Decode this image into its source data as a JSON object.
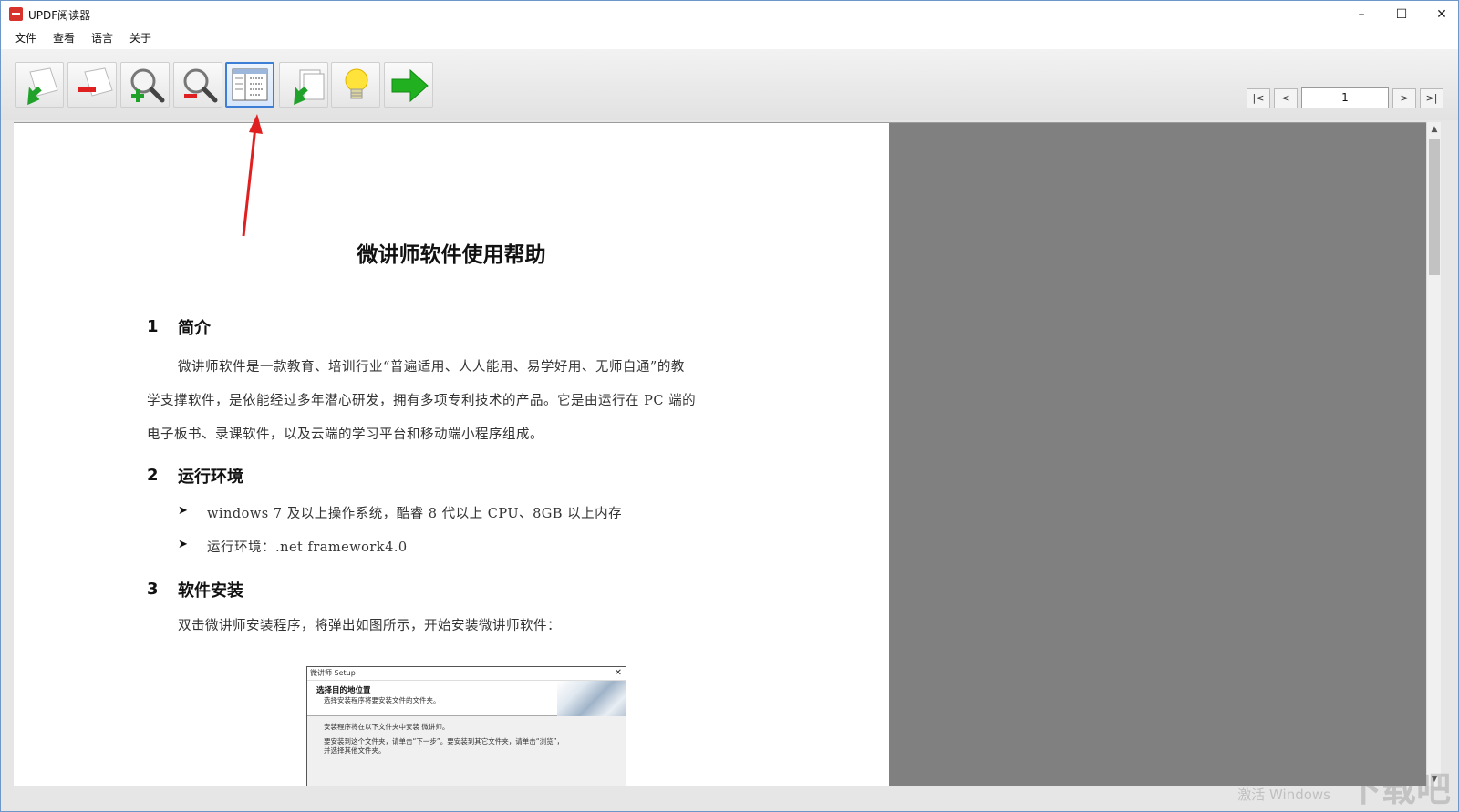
{
  "window": {
    "title": "UPDF阅读器",
    "minimize": "–",
    "maximize": "☐",
    "close": "✕"
  },
  "menu": [
    "文件",
    "查看",
    "语言",
    "关于"
  ],
  "toolbar": {
    "buttons": [
      {
        "name": "open-file-button",
        "icon": "open-file-icon"
      },
      {
        "name": "close-file-button",
        "icon": "close-file-icon"
      },
      {
        "name": "zoom-in-button",
        "icon": "zoom-in-icon"
      },
      {
        "name": "zoom-out-button",
        "icon": "zoom-out-icon"
      },
      {
        "name": "toggle-outline-button",
        "icon": "outline-panel-icon",
        "active": true
      },
      {
        "name": "export-button",
        "icon": "export-icon"
      },
      {
        "name": "tips-button",
        "icon": "lightbulb-icon"
      },
      {
        "name": "forward-button",
        "icon": "arrow-right-icon"
      }
    ]
  },
  "pager": {
    "first": "|<",
    "prev": "<",
    "page": "1",
    "next": ">",
    "last": ">|"
  },
  "document": {
    "title": "微讲师软件使用帮助",
    "sections": [
      {
        "num": "1",
        "title": "简介"
      },
      {
        "num": "2",
        "title": "运行环境"
      },
      {
        "num": "3",
        "title": "软件安装"
      }
    ],
    "intro_lines": [
      "微讲师软件是一款教育、培训行业“普遍适用、人人能用、易学好用、无师自通”的教",
      "学支撑软件，是依能经过多年潜心研发，拥有多项专利技术的产品。它是由运行在 PC 端的",
      "电子板书、录课软件，以及云端的学习平台和移动端小程序组成。"
    ],
    "env_items": [
      "windows 7 及以上操作系统，酷睿 8 代以上 CPU、8GB 以上内存",
      "运行环境：.net framework4.0"
    ],
    "bullet_glyph": "➤",
    "install_text": "双击微讲师安装程序，将弹出如图所示，开始安装微讲师软件：",
    "embedded": {
      "title": "微讲师 Setup",
      "close": "✕",
      "heading": "选择目的地位置",
      "subheading": "选择安装程序将要安装文件的文件夹。",
      "line1": "安装程序将在以下文件夹中安装 微讲师。",
      "line2": "要安装到这个文件夹，请单击“下一步”。要安装到其它文件夹，请单击“浏览”，",
      "line3": "并选择其他文件夹。"
    }
  },
  "scrollbar": {
    "up": "▲",
    "down": "▼"
  },
  "watermark": {
    "text": "激活 Windows",
    "logo": "下载吧"
  },
  "colors": {
    "accent": "#3d7fd6",
    "app_red": "#d8322d",
    "viewport_gray": "#808080",
    "annotation_red": "#e02020"
  }
}
